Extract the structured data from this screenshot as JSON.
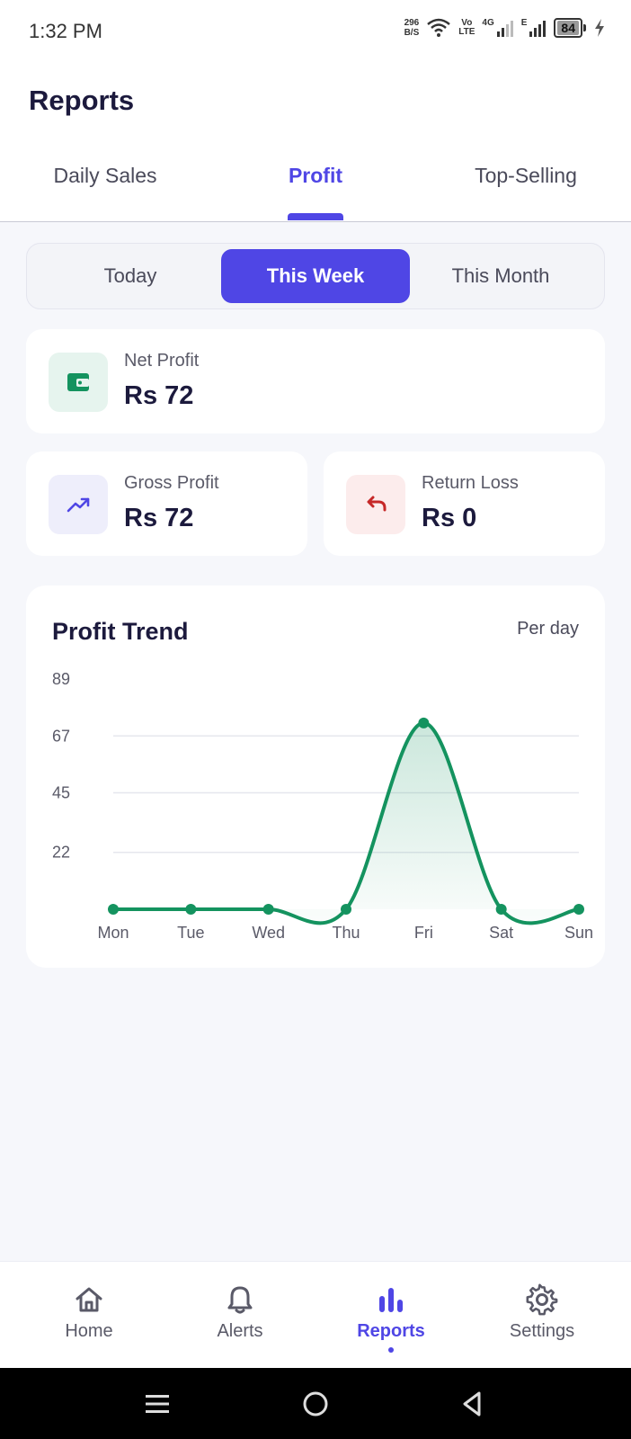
{
  "status_bar": {
    "time": "1:32 PM",
    "net_speed": "296",
    "net_unit": "B/S",
    "volte_top": "Vo",
    "volte_bottom": "LTE",
    "network_4g": "4G",
    "network_e": "E",
    "battery": "84"
  },
  "header": {
    "title": "Reports",
    "tabs": [
      {
        "label": "Daily Sales"
      },
      {
        "label": "Profit"
      },
      {
        "label": "Top-Selling"
      }
    ],
    "active_tab": "Profit"
  },
  "period": {
    "options": [
      {
        "label": "Today"
      },
      {
        "label": "This Week"
      },
      {
        "label": "This Month"
      }
    ],
    "selected": "This Week"
  },
  "cards": {
    "net_profit": {
      "label": "Net Profit",
      "value": "Rs 72",
      "icon": "wallet-icon"
    },
    "gross_profit": {
      "label": "Gross Profit",
      "value": "Rs 72",
      "icon": "trending-up-icon"
    },
    "return_loss": {
      "label": "Return Loss",
      "value": "Rs 0",
      "icon": "undo-icon"
    }
  },
  "chart": {
    "title": "Profit Trend",
    "subtitle": "Per day"
  },
  "chart_data": {
    "type": "line",
    "title": "Profit Trend",
    "subtitle": "Per day",
    "categories": [
      "Mon",
      "Tue",
      "Wed",
      "Thu",
      "Fri",
      "Sat",
      "Sun"
    ],
    "values": [
      0,
      0,
      0,
      0,
      72,
      0,
      0
    ],
    "y_ticks": [
      "89",
      "67",
      "45",
      "22"
    ],
    "y_tick_values": [
      89,
      67,
      45,
      22
    ],
    "ylim": [
      0,
      89
    ],
    "grid": true,
    "smooth": true,
    "line_color": "#14935f",
    "fill": "gradient"
  },
  "bottom_nav": {
    "items": [
      {
        "label": "Home",
        "icon": "home-icon"
      },
      {
        "label": "Alerts",
        "icon": "bell-icon"
      },
      {
        "label": "Reports",
        "icon": "bar-chart-icon"
      },
      {
        "label": "Settings",
        "icon": "gear-icon"
      }
    ],
    "active": "Reports"
  },
  "colors": {
    "accent": "#4f46e5",
    "green": "#14935f",
    "red": "#c62828",
    "text_dark": "#1c1a3d"
  }
}
